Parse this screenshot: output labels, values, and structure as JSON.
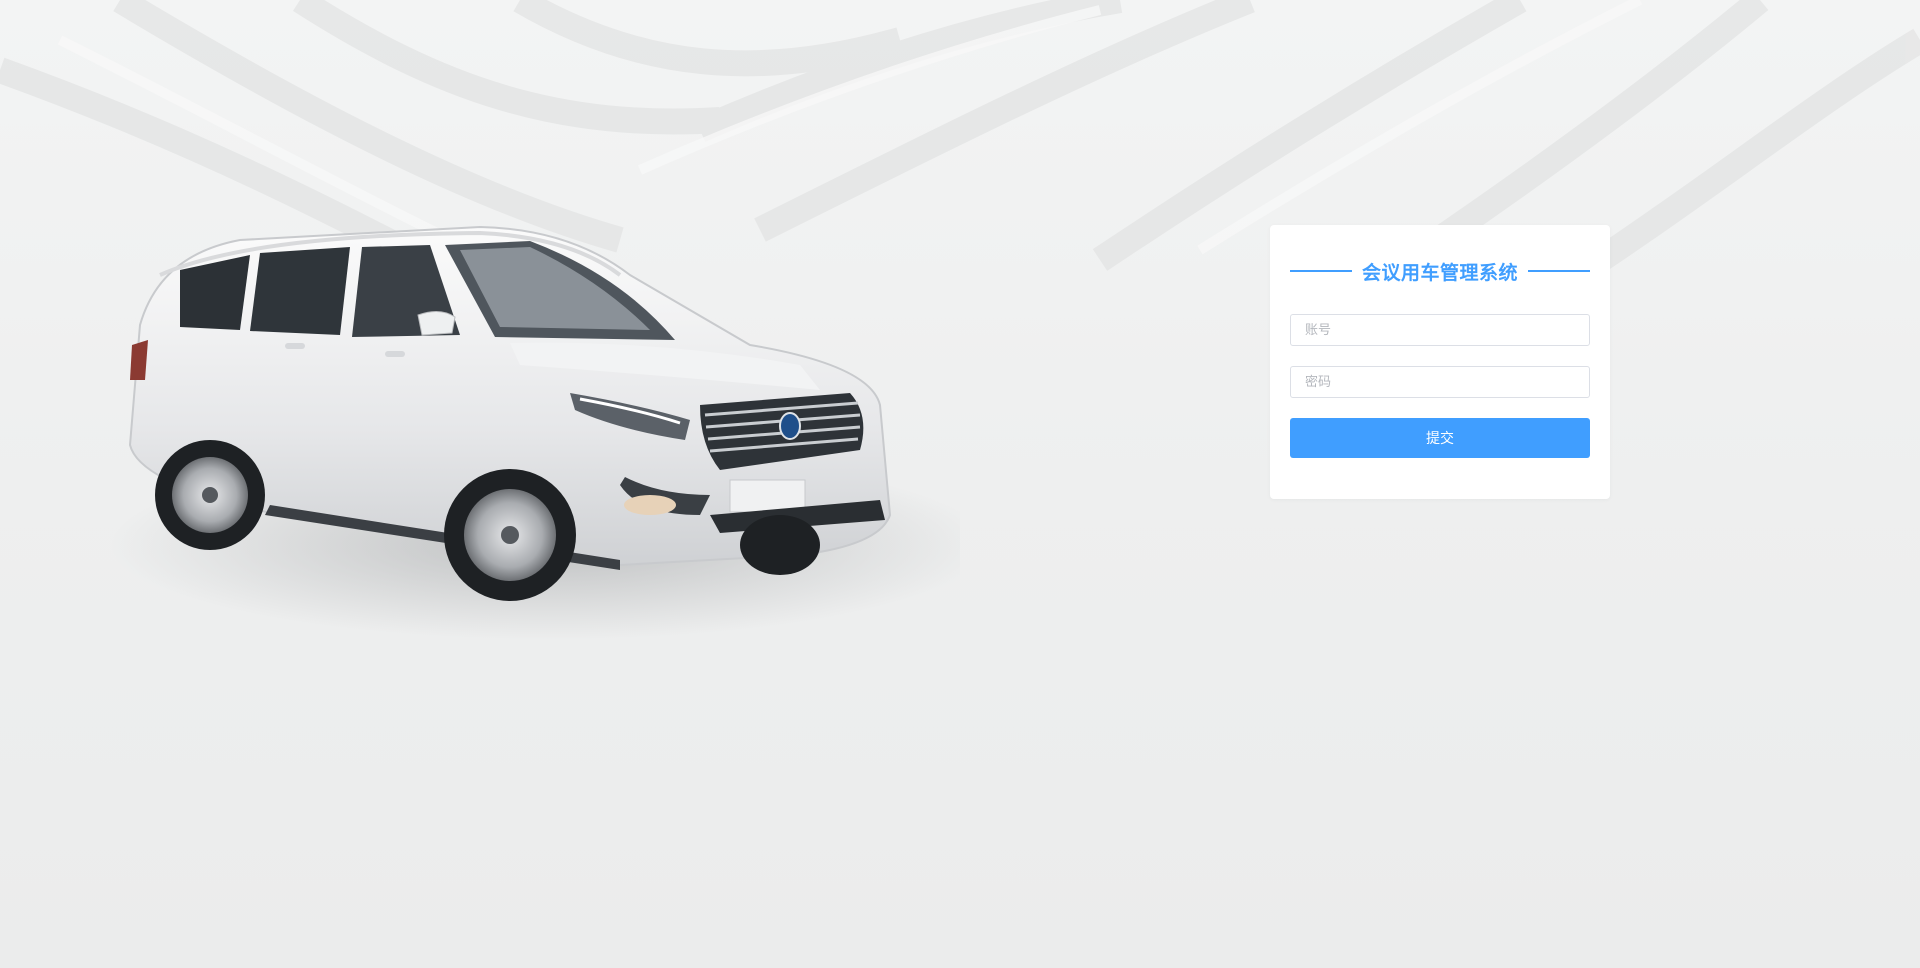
{
  "login": {
    "title": "会议用车管理系统",
    "account_placeholder": "账号",
    "password_placeholder": "密码",
    "submit_label": "提交"
  },
  "colors": {
    "accent": "#409eff",
    "background": "#eceded",
    "card": "#ffffff"
  },
  "icons": [
    "vehicle-illustration"
  ]
}
